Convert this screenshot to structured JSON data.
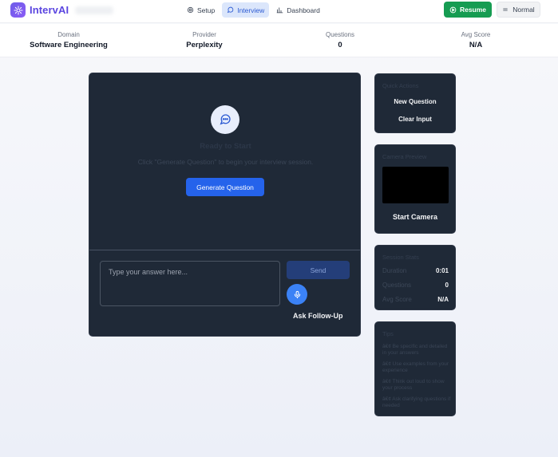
{
  "brand": {
    "name": "IntervAI",
    "logo_icon": "lightbulb-icon"
  },
  "nav": {
    "items": [
      {
        "label": "Setup",
        "icon": "gear-icon",
        "active": false
      },
      {
        "label": "Interview",
        "icon": "chat-icon",
        "active": true
      },
      {
        "label": "Dashboard",
        "icon": "bar-chart-icon",
        "active": false
      }
    ],
    "resume_label": "Resume",
    "normal_label": "Normal"
  },
  "stats": [
    {
      "label": "Domain",
      "value": "Software Engineering"
    },
    {
      "label": "Provider",
      "value": "Perplexity"
    },
    {
      "label": "Questions",
      "value": "0"
    },
    {
      "label": "Avg Score",
      "value": "N/A"
    }
  ],
  "main": {
    "ready_title": "Ready to Start",
    "ready_subtitle": "Click \"Generate Question\" to begin your interview session.",
    "generate_label": "Generate Question",
    "answer_placeholder": "Type your answer here...",
    "send_label": "Send",
    "followup_label": "Ask Follow-Up"
  },
  "quick_actions": {
    "title": "Quick Actions",
    "items": [
      "New Question",
      "Clear Input"
    ]
  },
  "camera": {
    "title": "Camera Preview",
    "start_label": "Start Camera"
  },
  "session": {
    "title": "Session Stats",
    "rows": [
      {
        "key": "Duration",
        "value": "0:01"
      },
      {
        "key": "Questions",
        "value": "0"
      },
      {
        "key": "Avg Score",
        "value": "N/A"
      }
    ]
  },
  "tips": {
    "title": "Tips",
    "items": [
      "â€¢ Be specific and detailed in your answers",
      "â€¢ Use examples from your experience",
      "â€¢ Think out loud to show your process",
      "â€¢ Ask clarifying questions if needed"
    ]
  },
  "colors": {
    "accent": "#2563eb",
    "brand": "#5b46e0",
    "resume": "#169c52",
    "panel": "#1f2937"
  }
}
